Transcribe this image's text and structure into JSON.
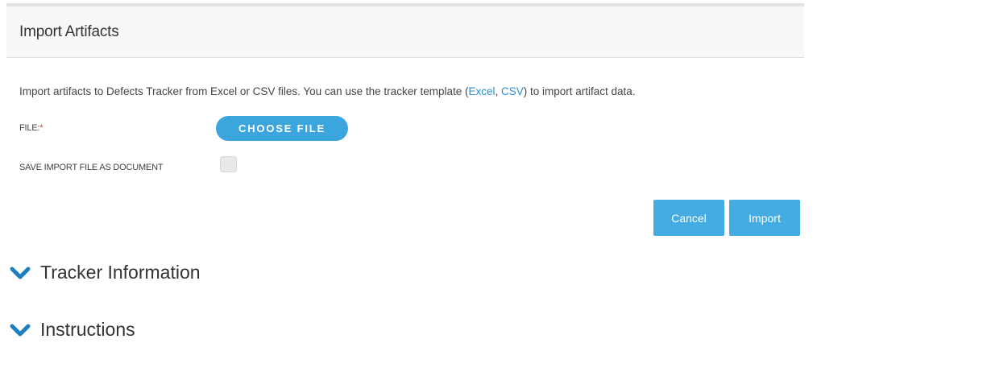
{
  "dialog": {
    "title": "Import Artifacts",
    "description": {
      "prefix": "Import artifacts to Defects Tracker from Excel or CSV files. You can use the tracker template (",
      "link_excel": "Excel",
      "separator": ", ",
      "link_csv": "CSV",
      "suffix": ") to import artifact data."
    },
    "file_label": "FILE:",
    "required_marker": "*",
    "choose_file_label": "CHOOSE FILE",
    "save_as_document_label": "SAVE IMPORT FILE AS DOCUMENT",
    "save_as_document_checked": false,
    "cancel_label": "Cancel",
    "import_label": "Import"
  },
  "sections": [
    {
      "label": "Tracker Information",
      "icon": "chevron-down-icon"
    },
    {
      "label": "Instructions",
      "icon": "chevron-down-icon"
    }
  ],
  "colors": {
    "accent": "#3aa6dd",
    "link": "#2a8fcf",
    "required": "#d04437"
  }
}
